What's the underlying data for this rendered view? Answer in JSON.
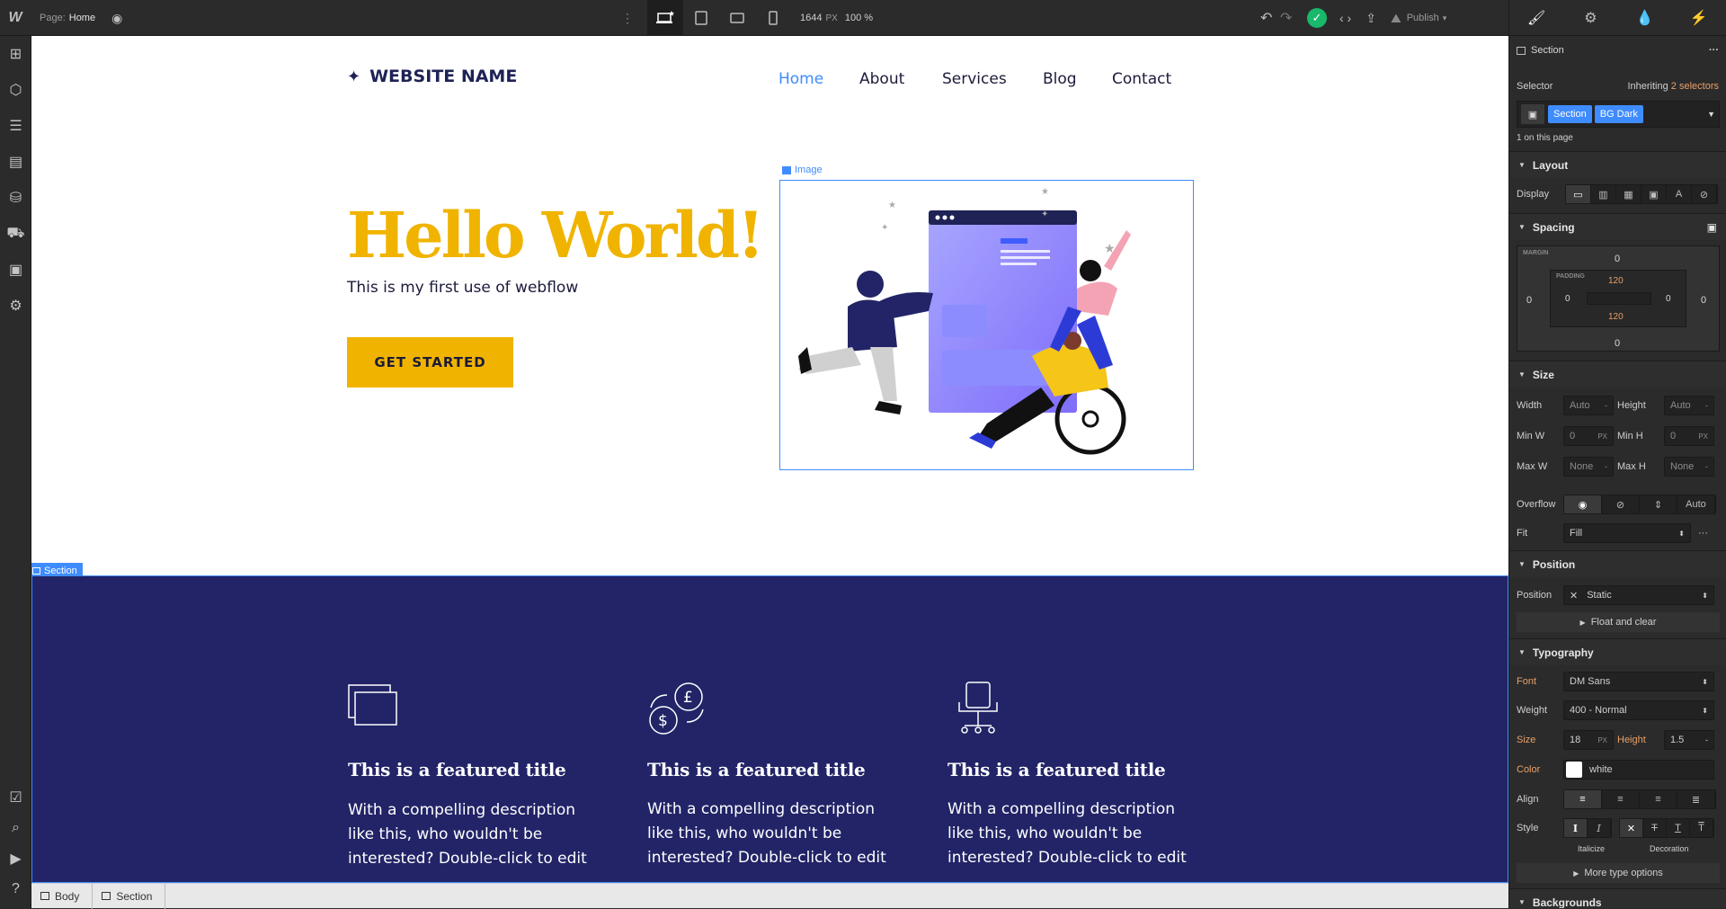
{
  "topbar": {
    "logo": "W",
    "page_label": "Page:",
    "page_name": "Home",
    "canvas_width": "1644",
    "canvas_unit": "PX",
    "zoom": "100 %",
    "publish": "Publish"
  },
  "canvas": {
    "site_name": "WEBSITE NAME",
    "nav": [
      "Home",
      "About",
      "Services",
      "Blog",
      "Contact"
    ],
    "hero_title": "Hello World!",
    "hero_subtitle": "This is my first use of webflow",
    "cta": "GET STARTED",
    "image_label": "Image",
    "section_label": "Section",
    "features": [
      {
        "title": "This is a featured title",
        "desc": "With a compelling description like this, who wouldn't be interested? Double-click to edit"
      },
      {
        "title": "This is a featured title",
        "desc": "With a compelling description like this, who wouldn't be interested? Double-click to edit"
      },
      {
        "title": "This is a featured title",
        "desc": "With a compelling description like this, who wouldn't be interested? Double-click to edit"
      }
    ],
    "colors": {
      "accent": "#f0b400",
      "dark_bg": "#222467",
      "nav_active": "#3f8cff"
    }
  },
  "breadcrumbs": [
    "Body",
    "Section"
  ],
  "panel": {
    "element": "Section",
    "selector_label": "Selector",
    "inheriting": "Inheriting",
    "inheriting_count": "2 selectors",
    "selectors": [
      "Section",
      "BG Dark"
    ],
    "on_page": "1 on this page",
    "layout": {
      "title": "Layout",
      "display": "Display"
    },
    "spacing": {
      "title": "Spacing",
      "margin": "MARGIN",
      "padding": "PADDING",
      "margin_top": "0",
      "margin_left": "0",
      "margin_right": "0",
      "margin_bottom": "0",
      "padding_top": "120",
      "padding_left": "0",
      "padding_right": "0",
      "padding_bottom": "120"
    },
    "size": {
      "title": "Size",
      "width": "Width",
      "height": "Height",
      "min_w": "Min W",
      "min_h": "Min H",
      "max_w": "Max W",
      "max_h": "Max H",
      "auto": "Auto",
      "zero": "0",
      "none": "None",
      "px": "PX",
      "dash": "-",
      "overflow": "Overflow",
      "overflow_auto": "Auto",
      "fit": "Fit",
      "fit_value": "Fill"
    },
    "position": {
      "title": "Position",
      "label": "Position",
      "value": "Static",
      "float": "Float and clear"
    },
    "typography": {
      "title": "Typography",
      "font": "Font",
      "font_value": "DM Sans",
      "weight": "Weight",
      "weight_value": "400 - Normal",
      "size": "Size",
      "size_value": "18",
      "size_unit": "PX",
      "height": "Height",
      "height_value": "1.5",
      "color": "Color",
      "color_value": "white",
      "align": "Align",
      "style": "Style",
      "italicize": "Italicize",
      "decoration": "Decoration",
      "more": "More type options"
    },
    "backgrounds": {
      "title": "Backgrounds"
    }
  }
}
